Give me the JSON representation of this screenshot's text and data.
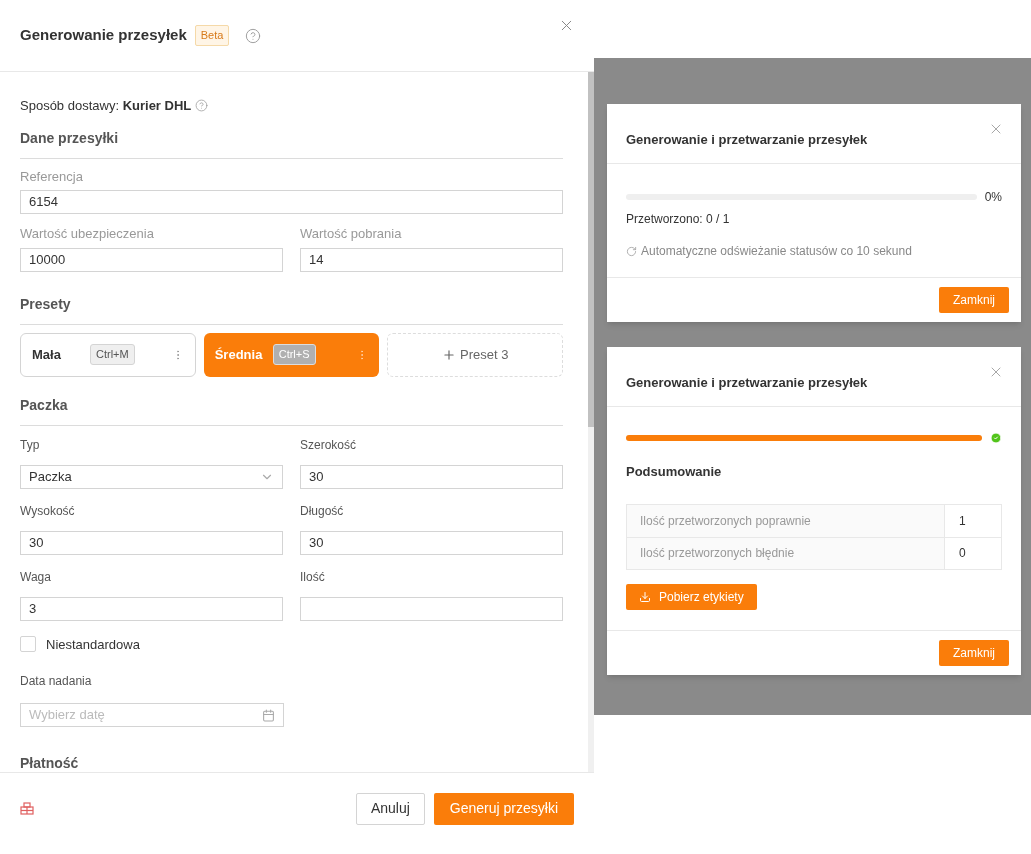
{
  "drawer": {
    "title": "Generowanie przesyłek",
    "badge": "Beta",
    "delivery_label": "Sposób dostawy:",
    "delivery_value": "Kurier DHL"
  },
  "shipment": {
    "heading": "Dane przesyłki",
    "reference": {
      "label": "Referencja",
      "value": "6154"
    },
    "insurance": {
      "label": "Wartość ubezpieczenia",
      "value": "10000"
    },
    "cod": {
      "label": "Wartość pobrania",
      "value": "14"
    }
  },
  "presets": {
    "heading": "Presety",
    "items": [
      {
        "name": "Mała",
        "shortcut": "Ctrl+M",
        "selected": false
      },
      {
        "name": "Średnia",
        "shortcut": "Ctrl+S",
        "selected": true
      }
    ],
    "add_label": "Preset 3"
  },
  "package": {
    "heading": "Paczka",
    "fields": [
      {
        "kind": "select",
        "label": "Typ",
        "value": "Paczka"
      },
      {
        "kind": "input",
        "label": "Szerokość",
        "value": "30"
      },
      {
        "kind": "input",
        "label": "Wysokość",
        "value": "30"
      },
      {
        "kind": "input",
        "label": "Długość",
        "value": "30"
      },
      {
        "kind": "input",
        "label": "Waga",
        "value": "3"
      },
      {
        "kind": "input",
        "label": "Ilość"
      }
    ],
    "nonstandard": {
      "label": "Niestandardowa",
      "checked": false
    },
    "date": {
      "label": "Data nadania",
      "placeholder": "Wybierz datę"
    }
  },
  "payment": {
    "heading": "Płatność"
  },
  "footer": {
    "cancel": "Anuluj",
    "submit": "Generuj przesyłki"
  },
  "modals": [
    {
      "kind": "progress",
      "title": "Generowanie i przetwarzanie przesyłek",
      "level": 0,
      "percent": "0%",
      "processed": "Przetworzono: 0 / 1",
      "note": "Automatyczne odświeżanie statusów co 10 sekund",
      "close": "Zamknij"
    },
    {
      "kind": "summary",
      "title": "Generowanie i przetwarzanie przesyłek",
      "level": 1,
      "complete": true,
      "summary_title": "Podsumowanie",
      "rows": [
        {
          "label": "Ilość przetworzonych poprawnie",
          "value": "1"
        },
        {
          "label": "Ilość przetworzonych błędnie",
          "value": "0"
        }
      ],
      "download": "Pobierz etykiety",
      "close": "Zamknij"
    }
  ]
}
